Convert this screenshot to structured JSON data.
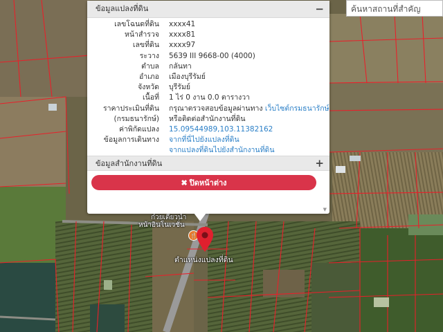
{
  "search": {
    "placeholder": "ค้นหาสถานที่สำคัญ"
  },
  "popup": {
    "header": "ข้อมูลแปลงที่ดิน",
    "header_toggle": "−",
    "rows": [
      {
        "label": "เลขโฉนดที่ดิน",
        "value": "xxxx41"
      },
      {
        "label": "หน้าสำรวจ",
        "value": "xxxx81"
      },
      {
        "label": "เลขที่ดิน",
        "value": "xxxx97"
      },
      {
        "label": "ระวาง",
        "value": "5639 III 9668-00 (4000)"
      },
      {
        "label": "ตำบล",
        "value": "กลันทา"
      },
      {
        "label": "อำเภอ",
        "value": "เมืองบุรีรัมย์"
      },
      {
        "label": "จังหวัด",
        "value": "บุรีรัมย์"
      },
      {
        "label": "เนื้อที่",
        "value": "1 ไร่ 0 งาน 0.0 ตารางวา"
      }
    ],
    "price_label": "ราคาประเมินที่ดิน",
    "price_value": "กรุณาตรวจสอบข้อมูลผ่านทาง",
    "price_link": "เว็บไซต์กรมธนารักษ์",
    "price_label2": "(กรมธนารักษ์)",
    "price_value2": "หรือติดต่อสำนักงานที่ดิน",
    "coord_label": "ค่าพิกัดแปลง",
    "coord_value": "15.09544989,103.11382162",
    "travel_label": "ข้อมูลการเดินทาง",
    "travel_link1": "จากที่นี่ไปยังแปลงที่ดิน",
    "travel_link2": "จากแปลงที่ดินไปยังสำนักงานที่ดิน",
    "office_header": "ข้อมูลสำนักงานที่ดิน",
    "office_toggle": "+",
    "close_icon": "✖",
    "close_label": "ปิดหน้าต่าง",
    "scroll_icon": "▼"
  },
  "map": {
    "shop_label": "ก๋วยเตี๋ยวน้ำ",
    "shop_label2": "หน้าอินโนเวชั่น",
    "pin_label": "ตำแหน่งแปลงที่ดิน",
    "pin_color": "#e0202e",
    "parcel_color": "#e8202a"
  }
}
